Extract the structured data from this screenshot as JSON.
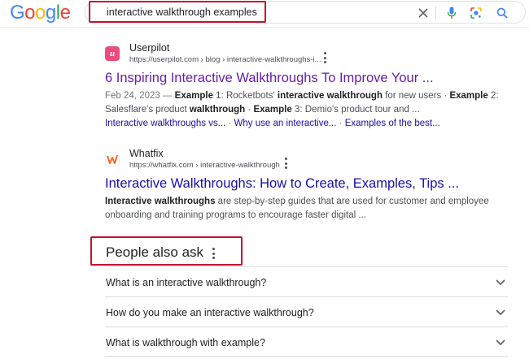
{
  "header": {
    "logo_letters": [
      {
        "char": "G",
        "color": "#4285F4"
      },
      {
        "char": "o",
        "color": "#EA4335"
      },
      {
        "char": "o",
        "color": "#FBBC05"
      },
      {
        "char": "g",
        "color": "#4285F4"
      },
      {
        "char": "l",
        "color": "#34A853"
      },
      {
        "char": "e",
        "color": "#EA4335"
      }
    ],
    "search_query": "interactive walkthrough examples",
    "icons": [
      "close-icon",
      "mic-icon",
      "lens-icon",
      "search-icon"
    ]
  },
  "results": [
    {
      "site_name": "Userpilot",
      "url": "https://userpilot.com › blog › interactive-walkthroughs-i...",
      "favicon_letter": "u",
      "favicon_bg": "#e94c7d",
      "title": "6 Inspiring Interactive Walkthroughs To Improve Your ...",
      "title_color": "#681da8",
      "snippet_date": "Feb 24, 2023 — ",
      "snippet_parts": [
        {
          "text": "Example",
          "bold": true
        },
        {
          "text": " 1: Rocketbots' ",
          "bold": false
        },
        {
          "text": "interactive walkthrough",
          "bold": true
        },
        {
          "text": " for new users · ",
          "bold": false
        },
        {
          "text": "Example",
          "bold": true
        },
        {
          "text": " 2: Salesflare's product ",
          "bold": false
        },
        {
          "text": "walkthrough",
          "bold": true
        },
        {
          "text": " · ",
          "bold": false
        },
        {
          "text": "Example",
          "bold": true
        },
        {
          "text": " 3: Demio's product tour and ...",
          "bold": false
        }
      ],
      "sitelinks": [
        "Interactive walkthroughs vs...",
        "Why use an interactive...",
        "Examples of the best..."
      ]
    },
    {
      "site_name": "Whatfix",
      "url": "https://whatfix.com › interactive-walkthrough",
      "favicon_letter": "w",
      "favicon_bg": "#ffffff",
      "title": "Interactive Walkthroughs: How to Create, Examples, Tips ...",
      "title_color": "#1a0dab",
      "snippet_date": "",
      "snippet_parts": [
        {
          "text": "Interactive walkthroughs",
          "bold": true
        },
        {
          "text": " are step-by-step guides that are used for customer and employee onboarding and training programs to encourage faster digital ...",
          "bold": false
        }
      ],
      "sitelinks": []
    }
  ],
  "people_also_ask": {
    "title": "People also ask",
    "questions": [
      "What is an interactive walkthrough?",
      "How do you make an interactive walkthrough?",
      "What is walkthrough with example?"
    ]
  },
  "colors": {
    "link_visited": "#681da8",
    "link": "#1a0dab",
    "annotation_red": "#c8102e"
  }
}
